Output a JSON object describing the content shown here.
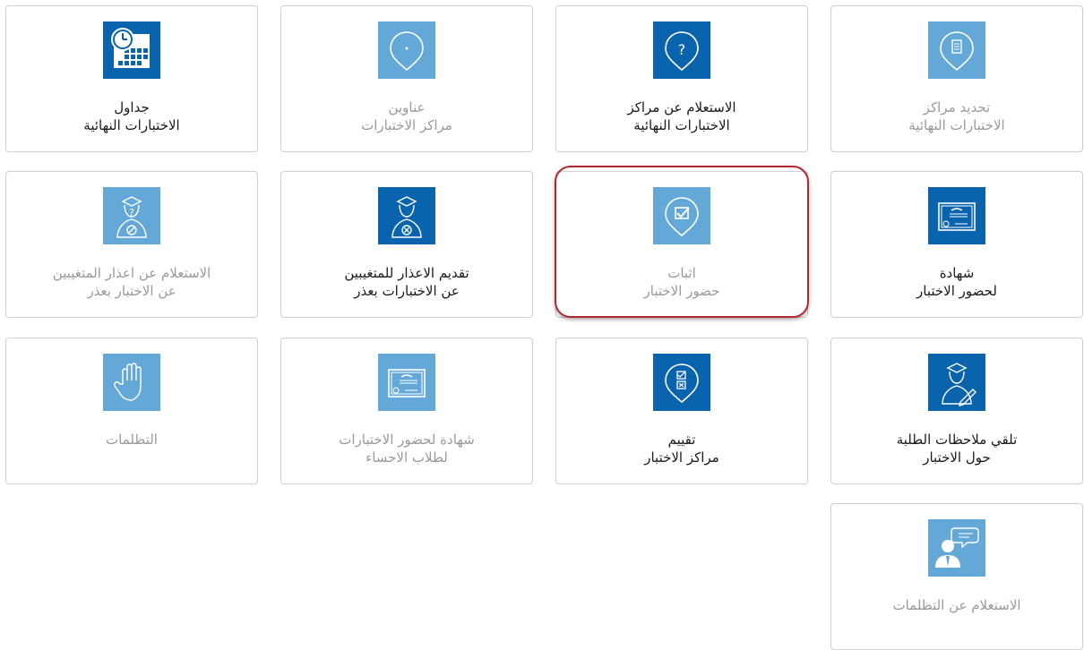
{
  "colors": {
    "icon_dark": "#0a64ad",
    "icon_light": "#64a8d8",
    "highlight": "#b3282d"
  },
  "cards": {
    "determine_centers": {
      "line1": "تحديد مراكز",
      "line2": "الاختبارات النهائية",
      "icon": "pin-document-icon",
      "state": "disabled"
    },
    "inquire_centers": {
      "line1": "الاستعلام عن مراكز",
      "line2": "الاختبارات النهائية",
      "icon": "pin-question-icon",
      "state": "enabled"
    },
    "addresses": {
      "line1": "عناوين",
      "line2": "مراكز الاختبارات",
      "icon": "pin-dot-icon",
      "state": "disabled"
    },
    "schedules": {
      "line1": "جداول",
      "line2": "الاختبارات النهائية",
      "icon": "calendar-clock-icon",
      "state": "enabled"
    },
    "certificate": {
      "line1": "شهادة",
      "line2": "لحضور الاختبار",
      "icon": "certificate-icon",
      "state": "enabled"
    },
    "proof_attendance": {
      "line1": "اثبات",
      "line2": "حضور الاختبار",
      "icon": "pin-check-icon",
      "state": "disabled",
      "highlighted": true
    },
    "submit_excuse": {
      "line1": "تقديم الاعذار للمتغيبين",
      "line2": "عن الاختبارات بعذر",
      "icon": "student-excuse-icon",
      "state": "enabled"
    },
    "inquire_excuse": {
      "line1": "الاستعلام عن اعذار المتغيبين",
      "line2": "عن الاختبار بعذر",
      "icon": "student-question-icon",
      "state": "disabled"
    },
    "feedback": {
      "line1": "تلقي ملاحظات الطلبة",
      "line2": "حول الاختبار",
      "icon": "student-feedback-icon",
      "state": "enabled"
    },
    "evaluate": {
      "line1": "تقييم",
      "line2": "مراكز الاختبار",
      "icon": "pin-checklist-icon",
      "state": "enabled"
    },
    "cert_ahsa": {
      "line1": "شهادة لحضور الاختبارات",
      "line2": "لطلاب الاحساء",
      "icon": "certificate-icon",
      "state": "disabled"
    },
    "grievances": {
      "line1": "التظلمات",
      "line2": "",
      "icon": "raised-hand-icon",
      "state": "disabled"
    },
    "inquire_grievances": {
      "line1": "الاستعلام عن التظلمات",
      "line2": "",
      "icon": "person-speech-icon",
      "state": "disabled"
    }
  }
}
